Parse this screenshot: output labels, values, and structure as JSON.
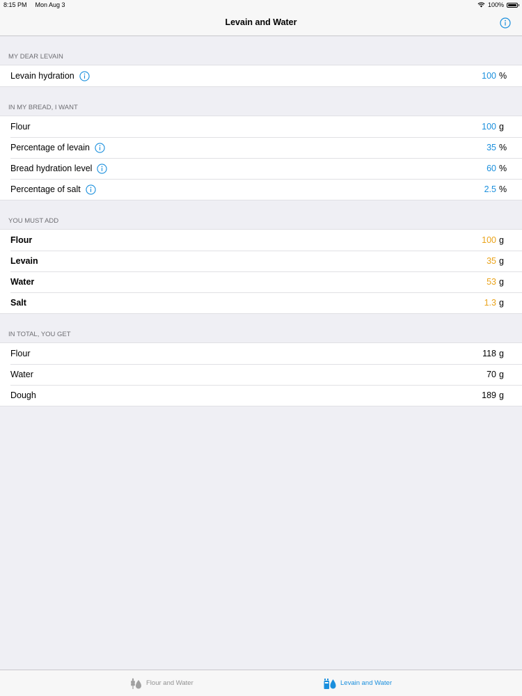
{
  "status": {
    "time": "8:15 PM",
    "date": "Mon Aug 3",
    "battery": "100%"
  },
  "nav": {
    "title": "Levain and Water"
  },
  "sections": {
    "levain": {
      "header": "MY DEAR LEVAIN",
      "rows": [
        {
          "label": "Levain hydration",
          "value": "100",
          "unit": "%"
        }
      ]
    },
    "bread": {
      "header": "IN MY BREAD, I WANT",
      "rows": [
        {
          "label": "Flour",
          "value": "100",
          "unit": "g"
        },
        {
          "label": "Percentage of levain",
          "value": "35",
          "unit": "%"
        },
        {
          "label": "Bread hydration level",
          "value": "60",
          "unit": "%"
        },
        {
          "label": "Percentage of salt",
          "value": "2.5",
          "unit": "%"
        }
      ]
    },
    "add": {
      "header": "YOU MUST ADD",
      "rows": [
        {
          "label": "Flour",
          "value": "100",
          "unit": "g"
        },
        {
          "label": "Levain",
          "value": "35",
          "unit": "g"
        },
        {
          "label": "Water",
          "value": "53",
          "unit": "g"
        },
        {
          "label": "Salt",
          "value": "1.3",
          "unit": "g"
        }
      ]
    },
    "total": {
      "header": "IN TOTAL, YOU GET",
      "rows": [
        {
          "label": "Flour",
          "value": "118",
          "unit": "g"
        },
        {
          "label": "Water",
          "value": "70",
          "unit": "g"
        },
        {
          "label": "Dough",
          "value": "189",
          "unit": "g"
        }
      ]
    }
  },
  "tabs": [
    {
      "label": "Flour and Water",
      "icon": "wheat-icon"
    },
    {
      "label": "Levain and Water",
      "icon": "jar-water-icon"
    }
  ],
  "colors": {
    "input": "#1a8fdd",
    "result": "#eaa31a",
    "active_tab": "#1a8fdd",
    "inactive_tab": "#929292"
  }
}
